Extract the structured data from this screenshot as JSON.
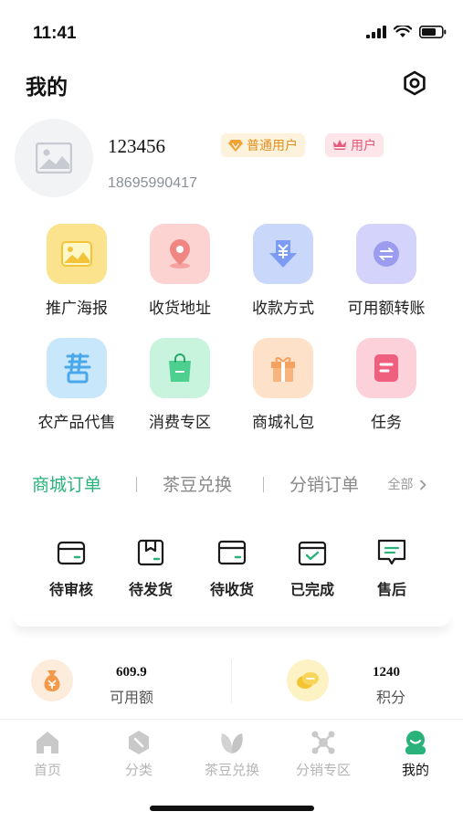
{
  "status_bar": {
    "time": "11:41"
  },
  "header": {
    "title": "我的"
  },
  "profile": {
    "username": "123456",
    "phone": "18695990417",
    "badges": [
      {
        "label": "普通用户",
        "icon": "diamond-icon"
      },
      {
        "label": "用户",
        "icon": "crown-icon"
      }
    ]
  },
  "features": [
    {
      "label": "推广海报",
      "icon": "image-icon",
      "color": "#fbe38e"
    },
    {
      "label": "收货地址",
      "icon": "location-pin-icon",
      "color": "#fcd3d1"
    },
    {
      "label": "收款方式",
      "icon": "yuan-download-icon",
      "color": "#c9d7fb"
    },
    {
      "label": "可用额转账",
      "icon": "transfer-icon",
      "color": "#d3d3fb"
    },
    {
      "label": "农产品代售",
      "icon": "sell-icon",
      "color": "#c8e7fb"
    },
    {
      "label": "消费专区",
      "icon": "shopping-bag-icon",
      "color": "#c8f3dd"
    },
    {
      "label": "商城礼包",
      "icon": "gift-icon",
      "color": "#fde1c8"
    },
    {
      "label": "任务",
      "icon": "task-icon",
      "color": "#fcd1da"
    }
  ],
  "order_tabs": {
    "tabs": [
      {
        "label": "商城订单",
        "active": true
      },
      {
        "label": "茶豆兑换",
        "active": false
      },
      {
        "label": "分销订单",
        "active": false
      }
    ],
    "all_label": "全部"
  },
  "order_status": [
    {
      "label": "待审核",
      "icon": "wallet-icon"
    },
    {
      "label": "待发货",
      "icon": "package-icon"
    },
    {
      "label": "待收货",
      "icon": "card-icon"
    },
    {
      "label": "已完成",
      "icon": "check-box-icon"
    },
    {
      "label": "售后",
      "icon": "message-icon"
    }
  ],
  "wallet": [
    {
      "value": "609.9",
      "label": "可用额",
      "icon": "money-bag-icon"
    },
    {
      "value": "1240",
      "label": "积分",
      "icon": "coins-icon"
    }
  ],
  "tabbar": [
    {
      "label": "首页",
      "icon": "home-icon",
      "active": false
    },
    {
      "label": "分类",
      "icon": "category-icon",
      "active": false
    },
    {
      "label": "茶豆兑换",
      "icon": "leaf-icon",
      "active": false
    },
    {
      "label": "分销专区",
      "icon": "network-icon",
      "active": false
    },
    {
      "label": "我的",
      "icon": "user-icon",
      "active": true
    }
  ],
  "colors": {
    "accent": "#2ab27b",
    "text": "#222222",
    "muted": "#888888"
  }
}
